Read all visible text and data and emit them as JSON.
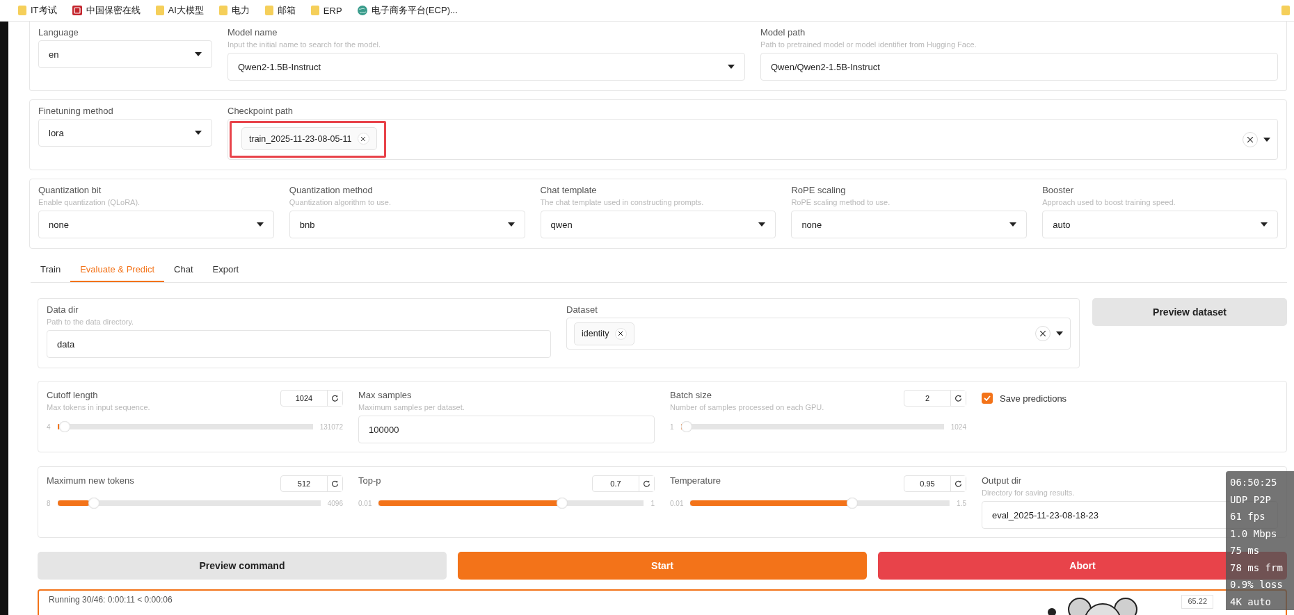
{
  "bookmarks": [
    {
      "label": "IT考试"
    },
    {
      "label": "中国保密在线"
    },
    {
      "label": "AI大模型"
    },
    {
      "label": "电力"
    },
    {
      "label": "邮箱"
    },
    {
      "label": "ERP"
    },
    {
      "label": "电子商务平台(ECP)..."
    }
  ],
  "top_cards": [
    {
      "fields": [
        {
          "kind": "dropdown",
          "label": "Language",
          "value": "en"
        },
        {
          "kind": "dropdown",
          "label": "Model name",
          "hint": "Input the initial name to search for the model.",
          "value": "Qwen2-1.5B-Instruct"
        },
        {
          "kind": "text",
          "label": "Model path",
          "hint": "Path to pretrained model or model identifier from Hugging Face.",
          "value": "Qwen/Qwen2-1.5B-Instruct"
        }
      ]
    },
    {
      "fields": [
        {
          "kind": "dropdown",
          "label": "Finetuning method",
          "value": "lora"
        },
        {
          "kind": "multiselect",
          "label": "Checkpoint path",
          "chips": [
            {
              "label": "train_2025-11-23-08-05-11",
              "highlighted": true
            }
          ]
        }
      ]
    },
    {
      "fields": [
        {
          "kind": "dropdown",
          "label": "Quantization bit",
          "hint": "Enable quantization (QLoRA).",
          "value": "none"
        },
        {
          "kind": "dropdown",
          "label": "Quantization method",
          "hint": "Quantization algorithm to use.",
          "value": "bnb"
        },
        {
          "kind": "dropdown",
          "label": "Chat template",
          "hint": "The chat template used in constructing prompts.",
          "value": "qwen"
        },
        {
          "kind": "dropdown",
          "label": "RoPE scaling",
          "hint": "RoPE scaling method to use.",
          "value": "none"
        },
        {
          "kind": "dropdown",
          "label": "Booster",
          "hint": "Approach used to boost training speed.",
          "value": "auto"
        }
      ]
    }
  ],
  "tabs": [
    {
      "label": "Train",
      "selected": false
    },
    {
      "label": "Evaluate & Predict",
      "selected": true
    },
    {
      "label": "Chat",
      "selected": false
    },
    {
      "label": "Export",
      "selected": false
    }
  ],
  "data_card": {
    "fields": [
      {
        "kind": "text",
        "label": "Data dir",
        "hint": "Path to the data directory.",
        "value": "data"
      },
      {
        "kind": "multiselect",
        "label": "Dataset",
        "chips": [
          {
            "label": "identity",
            "highlighted": false
          }
        ]
      }
    ],
    "button": "Preview dataset"
  },
  "param_cards": [
    {
      "params": [
        {
          "kind": "slider",
          "label": "Cutoff length",
          "hint": "Max tokens in input sequence.",
          "value": "1024",
          "min": "4",
          "max": "131072",
          "level": 0.008
        },
        {
          "kind": "text",
          "label": "Max samples",
          "hint": "Maximum samples per dataset.",
          "value": "100000"
        },
        {
          "kind": "slider",
          "label": "Batch size",
          "hint": "Number of samples processed on each GPU.",
          "value": "2",
          "min": "1",
          "max": "1024",
          "level": 0.001
        },
        {
          "kind": "checkbox",
          "label": "Save predictions",
          "checked": true
        }
      ]
    },
    {
      "params": [
        {
          "kind": "slider",
          "label": "Maximum new tokens",
          "value": "512",
          "min": "8",
          "max": "4096",
          "level": 0.123
        },
        {
          "kind": "slider",
          "label": "Top-p",
          "value": "0.7",
          "min": "0.01",
          "max": "1",
          "level": 0.7
        },
        {
          "kind": "slider",
          "label": "Temperature",
          "value": "0.95",
          "min": "0.01",
          "max": "1.5",
          "level": 0.63
        },
        {
          "kind": "text",
          "label": "Output dir",
          "hint": "Directory for saving results.",
          "value": "eval_2025-11-23-08-18-23"
        }
      ]
    }
  ],
  "actions": [
    {
      "label": "Preview command",
      "kind": "secondary"
    },
    {
      "label": "Start",
      "kind": "primary"
    },
    {
      "label": "Abort",
      "kind": "stop"
    }
  ],
  "progress": {
    "text": "Running 30/46: 0:00:11 < 0:00:06",
    "value": "65.22"
  },
  "stats_overlay": [
    "06:50:25",
    "UDP P2P",
    "61 fps",
    "1.0 Mbps",
    "75 ms",
    "78 ms frm",
    "0.9% loss",
    "4K auto"
  ]
}
